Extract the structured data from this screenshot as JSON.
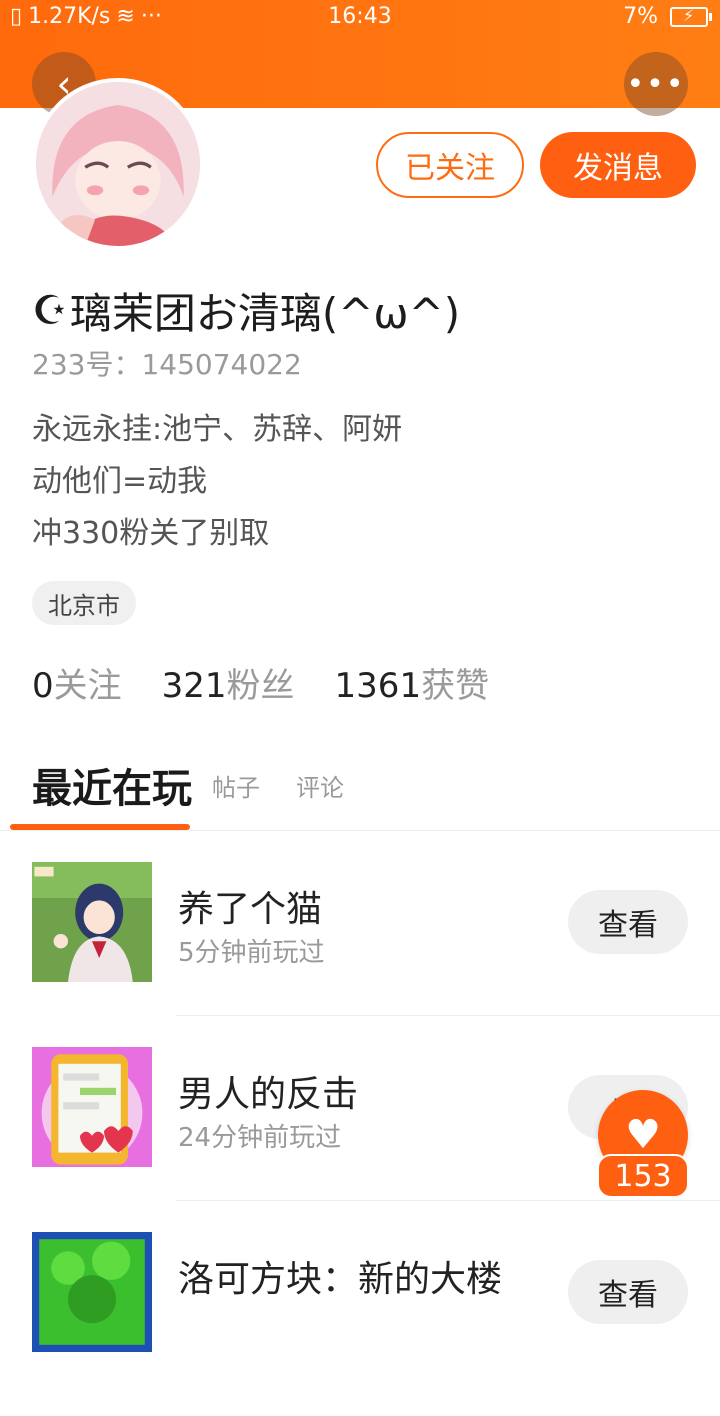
{
  "status_bar": {
    "speed": "1.27K/s",
    "dots": "···",
    "time": "16:43",
    "battery": "7%"
  },
  "colors": {
    "accent": "#ff5f10",
    "header": "#ff6a0c"
  },
  "header": {
    "back_icon": "chevron-left-icon",
    "more_icon": "more-dots-icon"
  },
  "actions": {
    "follow_label": "已关注",
    "message_label": "发消息"
  },
  "profile": {
    "name": "璃茉团お清璃(^ω^)",
    "moon_glyph": "☪",
    "uid": "233号：145074022",
    "bio": [
      "永远永挂:池宁、苏辞、阿妍",
      "动他们=动我",
      "冲330粉关了别取"
    ],
    "location": "北京市"
  },
  "stats": [
    {
      "num": "0",
      "label": "关注"
    },
    {
      "num": "321",
      "label": "粉丝"
    },
    {
      "num": "1361",
      "label": "获赞"
    }
  ],
  "tabs": [
    "最近在玩",
    "帖子",
    "评论"
  ],
  "games": [
    {
      "title": "养了个猫",
      "time": "5分钟前玩过",
      "button": "查看"
    },
    {
      "title": "男人的反击",
      "time": "24分钟前玩过",
      "button": "查"
    },
    {
      "title": "洛可方块：新的大楼",
      "time": "",
      "button": "查看"
    }
  ],
  "like": {
    "icon": "heart-icon",
    "count": "153"
  }
}
